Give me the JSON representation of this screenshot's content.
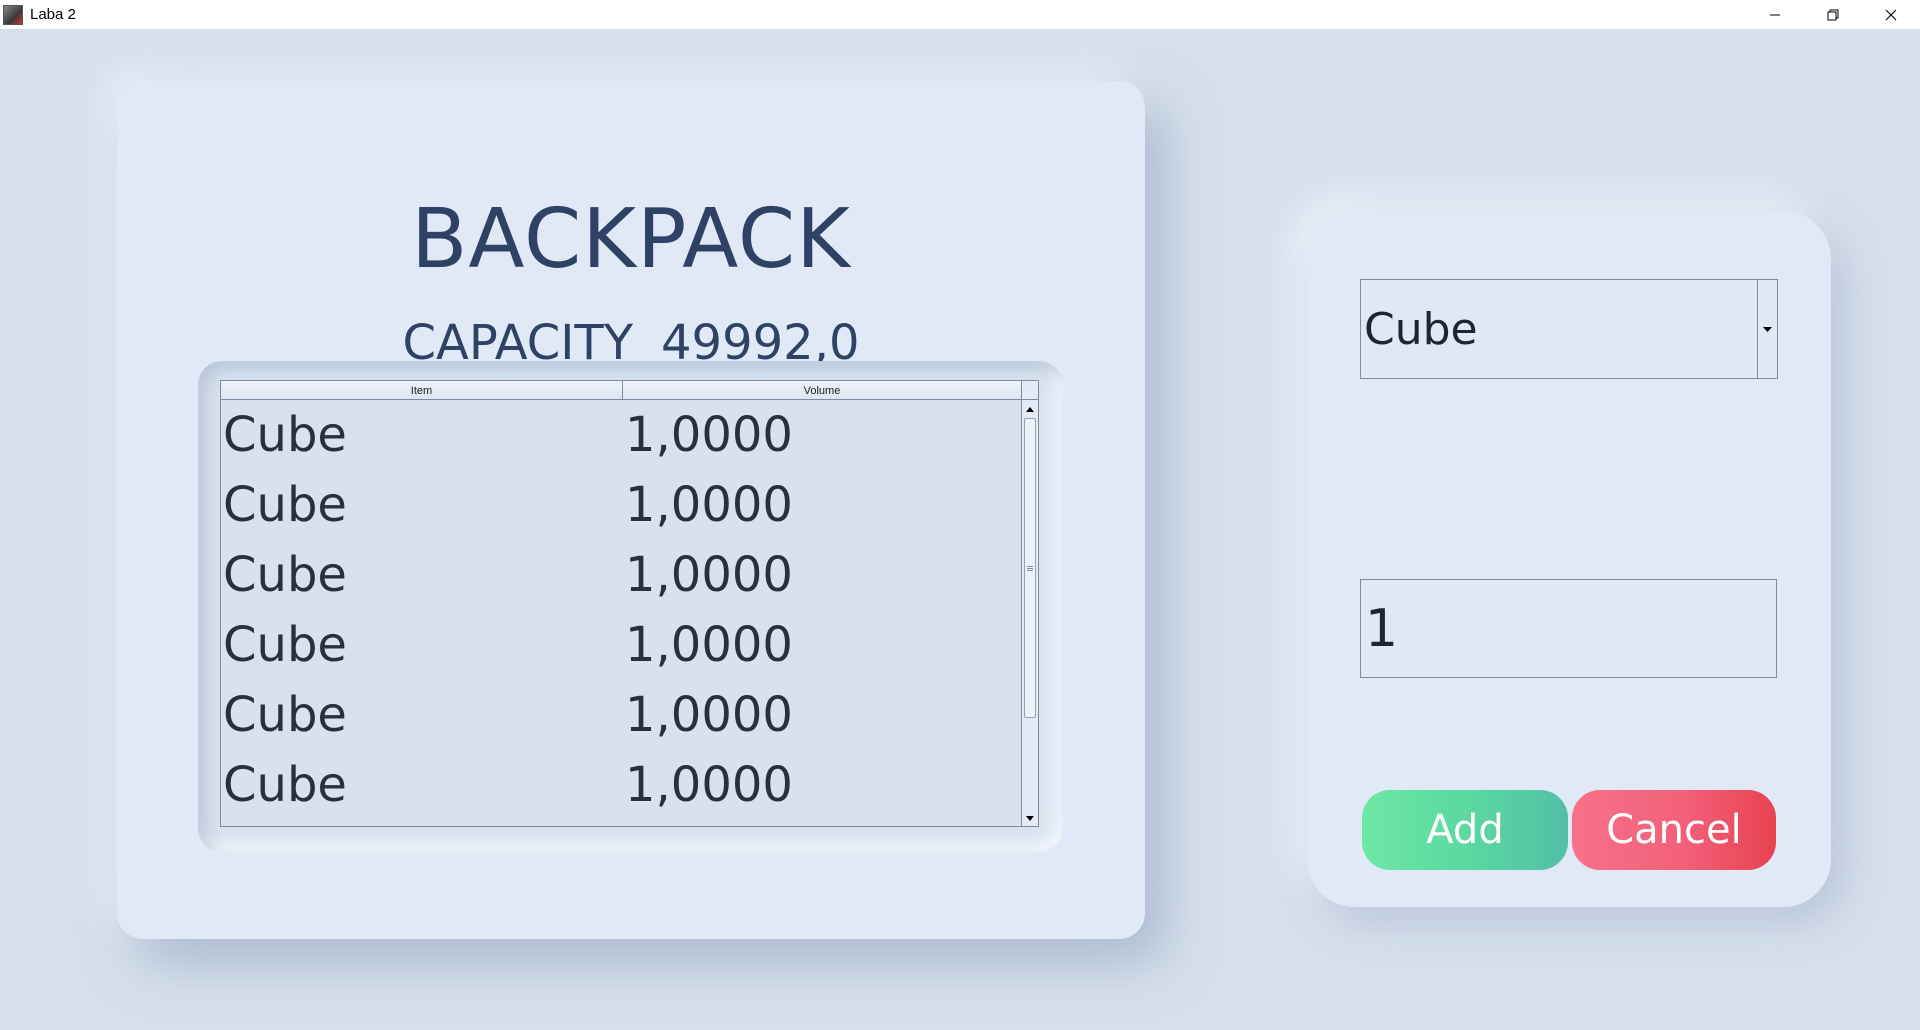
{
  "window": {
    "title": "Laba 2",
    "controls": [
      "minimize",
      "restore",
      "close"
    ]
  },
  "main": {
    "heading": "BACKPACK",
    "capacity_label": "CAPACITY",
    "capacity_value": "49992,0",
    "table": {
      "columns": [
        "Item",
        "Volume"
      ],
      "rows": [
        {
          "item": "Cube",
          "volume": "1,0000"
        },
        {
          "item": "Cube",
          "volume": "1,0000"
        },
        {
          "item": "Cube",
          "volume": "1,0000"
        },
        {
          "item": "Cube",
          "volume": "1,0000"
        },
        {
          "item": "Cube",
          "volume": "1,0000"
        },
        {
          "item": "Cube",
          "volume": "1,0000"
        }
      ]
    }
  },
  "form": {
    "shape_select": {
      "value": "Cube"
    },
    "quantity_input": {
      "value": "1"
    },
    "add_label": "Add",
    "cancel_label": "Cancel"
  },
  "colors": {
    "background": "#d6e0ec",
    "card": "#e0e9f5",
    "heading": "#2f4266",
    "add_gradient": [
      "#6ee8a5",
      "#52bfa8"
    ],
    "cancel_gradient": [
      "#f77189",
      "#e84250"
    ]
  }
}
